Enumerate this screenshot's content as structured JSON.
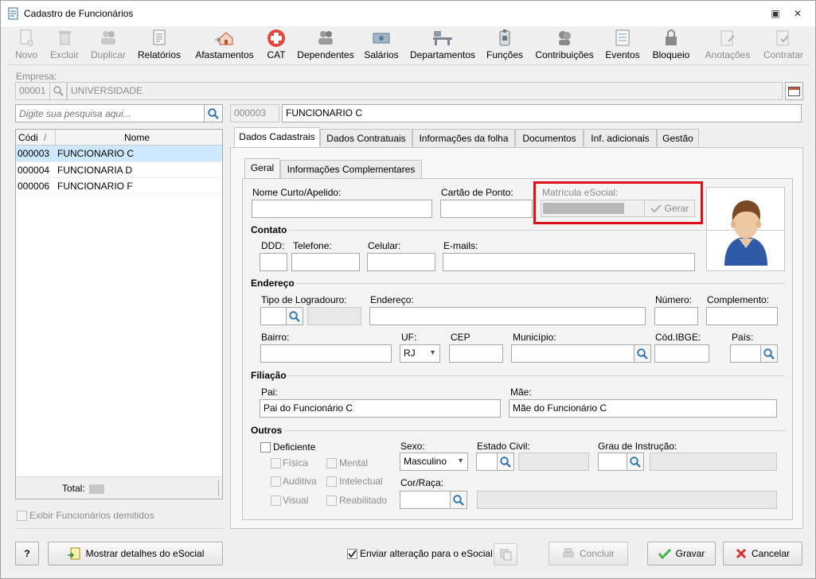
{
  "window": {
    "title": "Cadastro de Funcionários"
  },
  "toolbar": [
    {
      "label": "Novo",
      "icon": "new-document-icon",
      "enabled": false
    },
    {
      "label": "Excluir",
      "icon": "trash-icon",
      "enabled": false
    },
    {
      "label": "Duplicar",
      "icon": "users-icon",
      "enabled": false
    },
    {
      "label": "Relatórios",
      "icon": "report-icon",
      "enabled": true
    },
    {
      "label": "Afastamentos",
      "icon": "house-arrow-icon",
      "enabled": true
    },
    {
      "label": "CAT",
      "icon": "medical-cross-icon",
      "enabled": true
    },
    {
      "label": "Dependentes",
      "icon": "users-icon",
      "enabled": true
    },
    {
      "label": "Salários",
      "icon": "money-icon",
      "enabled": true
    },
    {
      "label": "Departamentos",
      "icon": "desk-icon",
      "enabled": true
    },
    {
      "label": "Funções",
      "icon": "badge-icon",
      "enabled": true
    },
    {
      "label": "Contribuições",
      "icon": "contributors-icon",
      "enabled": true
    },
    {
      "label": "Eventos",
      "icon": "list-icon",
      "enabled": true
    },
    {
      "label": "Bloqueio",
      "icon": "lock-icon",
      "enabled": true
    },
    {
      "label": "Anotações",
      "icon": "notes-icon",
      "enabled": false
    },
    {
      "label": "Contratar",
      "icon": "contract-icon",
      "enabled": false
    }
  ],
  "empresa": {
    "label": "Empresa:",
    "code": "00001",
    "name": "UNIVERSIDADE"
  },
  "search": {
    "placeholder": "Digite sua pesquisa aqui..."
  },
  "current": {
    "code": "000003",
    "name": "FUNCIONARIO C"
  },
  "grid": {
    "headers": [
      "Códi",
      "Nome"
    ],
    "sort_mark": "/",
    "rows": [
      {
        "code": "000003",
        "name": "FUNCIONARIO C",
        "selected": true
      },
      {
        "code": "000004",
        "name": "FUNCIONARIA D",
        "selected": false
      },
      {
        "code": "000006",
        "name": "FUNCIONARIO F",
        "selected": false
      }
    ],
    "total_label": "Total:"
  },
  "exibir_demitidos": {
    "label": "Exibir Funcionários demitidos",
    "checked": false
  },
  "tabs": [
    "Dados Cadastrais",
    "Dados Contratuais",
    "Informações da folha",
    "Documentos",
    "Inf. adicionais",
    "Gestão"
  ],
  "subtabs": [
    "Geral",
    "Informações Complementares"
  ],
  "geral": {
    "nome_curto": "Nome Curto/Apelido:",
    "cartao_ponto": "Cartão de Ponto:",
    "matricula_esocial": "Matrícula eSocial:",
    "gerar": "Gerar",
    "contato": "Contato",
    "ddd": "DDD:",
    "telefone": "Telefone:",
    "celular": "Celular:",
    "emails": "E-mails:",
    "endereco_group": "Endereço",
    "tipo_logradouro": "Tipo de Logradouro:",
    "endereco": "Endereço:",
    "numero": "Número:",
    "complemento": "Complemento:",
    "bairro": "Bairro:",
    "uf": "UF:",
    "uf_value": "RJ",
    "cep": "CEP",
    "municipio": "Município:",
    "cod_ibge": "Cód.IBGE:",
    "pais": "País:",
    "filiacao": "Filiação",
    "pai": "Pai:",
    "pai_value": "Pai do Funcionário C",
    "mae": "Mãe:",
    "mae_value": "Mãe do Funcionário C",
    "outros": "Outros",
    "deficiente": "Deficiente",
    "fisica": "Física",
    "mental": "Mental",
    "auditiva": "Auditiva",
    "intelectual": "Intelectual",
    "visual": "Visual",
    "reabilitado": "Reabilitado",
    "sexo": "Sexo:",
    "sexo_value": "Masculino",
    "estado_civil": "Estado Civil:",
    "grau_instrucao": "Grau de Instrução:",
    "cor_raca": "Cor/Raça:"
  },
  "footer": {
    "help": "?",
    "mostrar_detalhes": "Mostrar detalhes do eSocial",
    "enviar_alteracao": "Enviar alteração para o eSocial",
    "enviar_checked": true,
    "concluir": "Concluir",
    "gravar": "Gravar",
    "cancelar": "Cancelar"
  },
  "colors": {
    "highlight": "#e0101a",
    "selection": "#cde8ff",
    "accent_green": "#4caf50",
    "cancel_red": "#d9302c"
  }
}
